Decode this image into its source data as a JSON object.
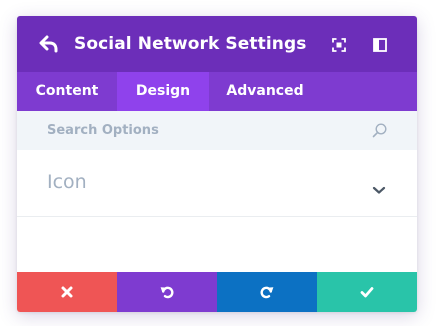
{
  "header": {
    "title": "Social Network Settings",
    "back_icon": "back-arrow-icon",
    "expand_icon": "expand-icon",
    "sidebar_icon": "sidebar-toggle-icon"
  },
  "tabs": [
    {
      "label": "Content",
      "active": false
    },
    {
      "label": "Design",
      "active": true
    },
    {
      "label": "Advanced",
      "active": false
    }
  ],
  "search": {
    "placeholder": "Search Options",
    "value": ""
  },
  "toggle": {
    "title": "Icon",
    "icon": "chevron-down-icon",
    "open": false
  },
  "footer": {
    "discard_icon": "close-icon",
    "undo_icon": "undo-icon",
    "redo_icon": "redo-icon",
    "save_icon": "checkmark-icon"
  },
  "colors": {
    "header": "#6c2eb9",
    "tabs": "#7e3bd0",
    "tab_active": "#8f42ec",
    "discard": "#ef5555",
    "undo": "#7e3bd0",
    "redo": "#0c71c3",
    "save": "#29c4a9"
  }
}
